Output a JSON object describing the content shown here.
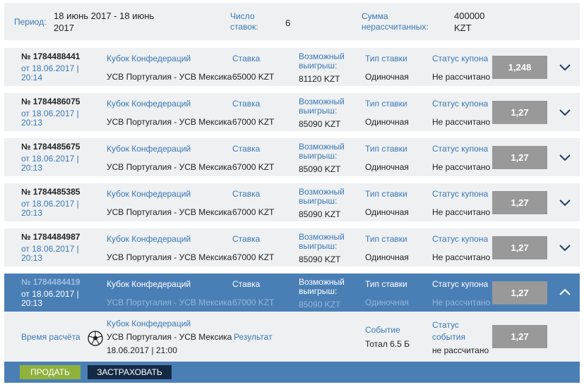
{
  "summary": {
    "period_label": "Период:",
    "period_value": "18 июнь 2017 - 18 июнь 2017",
    "bets_label": "Число ставок:",
    "bets_value": "6",
    "sum_label": "Сумма нерассчитанных:",
    "sum_value": "400000 KZT"
  },
  "labels": {
    "stake": "Ставка",
    "possible_win": "Возможный выигрыш:",
    "bet_type": "Тип ставки",
    "coupon_status": "Статус купона"
  },
  "bets": [
    {
      "number": "№ 1784488441",
      "date": "от 18.06.2017 | 20:14",
      "tournament": "Кубок Конфедераций",
      "match": "УСВ Португалия - УСВ Мексика",
      "stake": "65000 KZT",
      "win": "81120 KZT",
      "type": "Одиночная",
      "status": "Не рассчитано",
      "coef": "1,248"
    },
    {
      "number": "№ 1784486075",
      "date": "от 18.06.2017 | 20:13",
      "tournament": "Кубок Конфедераций",
      "match": "УСВ Португалия - УСВ Мексика",
      "stake": "67000 KZT",
      "win": "85090 KZT",
      "type": "Одиночная",
      "status": "Не рассчитано",
      "coef": "1,27"
    },
    {
      "number": "№ 1784485675",
      "date": "от 18.06.2017 | 20:13",
      "tournament": "Кубок Конфедераций",
      "match": "УСВ Португалия - УСВ Мексика",
      "stake": "67000 KZT",
      "win": "85090 KZT",
      "type": "Одиночная",
      "status": "Не рассчитано",
      "coef": "1,27"
    },
    {
      "number": "№ 1784485385",
      "date": "от 18.06.2017 | 20:13",
      "tournament": "Кубок Конфедераций",
      "match": "УСВ Португалия - УСВ Мексика",
      "stake": "67000 KZT",
      "win": "85090 KZT",
      "type": "Одиночная",
      "status": "Не рассчитано",
      "coef": "1,27"
    },
    {
      "number": "№ 1784484987",
      "date": "от 18.06.2017 | 20:13",
      "tournament": "Кубок Конфедераций",
      "match": "УСВ Португалия - УСВ Мексика",
      "stake": "67000 KZT",
      "win": "85090 KZT",
      "type": "Одиночная",
      "status": "Не рассчитано",
      "coef": "1,27"
    },
    {
      "number": "№ 1784484419",
      "date": "от 18.06.2017 | 20:13",
      "tournament": "Кубок Конфедераций",
      "match": "УСВ Португалия - УСВ Мексика",
      "stake": "67000 KZT",
      "win": "85090 KZT",
      "type": "Одиночная",
      "status": "Не рассчитано",
      "coef": "1,27"
    }
  ],
  "detail": {
    "settle_time_label": "Время расчёта",
    "tournament": "Кубок Конфедераций",
    "match": "УСВ Португалия - УСВ Мексика",
    "datetime": "18.06.2017 | 21:00",
    "result_label": "Результат",
    "event_label": "Событие",
    "event_value": "Тотал 6.5 Б",
    "event_status_label": "Статус события",
    "event_status_value": "не рассчитано",
    "coef": "1,27",
    "icon": "soccer-ball-icon"
  },
  "actions": {
    "sell": "ПРОДАТЬ",
    "insure": "ЗАСТРАХОВАТЬ"
  },
  "colors": {
    "accent": "#3a78b5",
    "active_row": "#4a7fb6",
    "coef_bg": "#999999",
    "sell": "#8fb23c",
    "insure": "#142a44"
  }
}
